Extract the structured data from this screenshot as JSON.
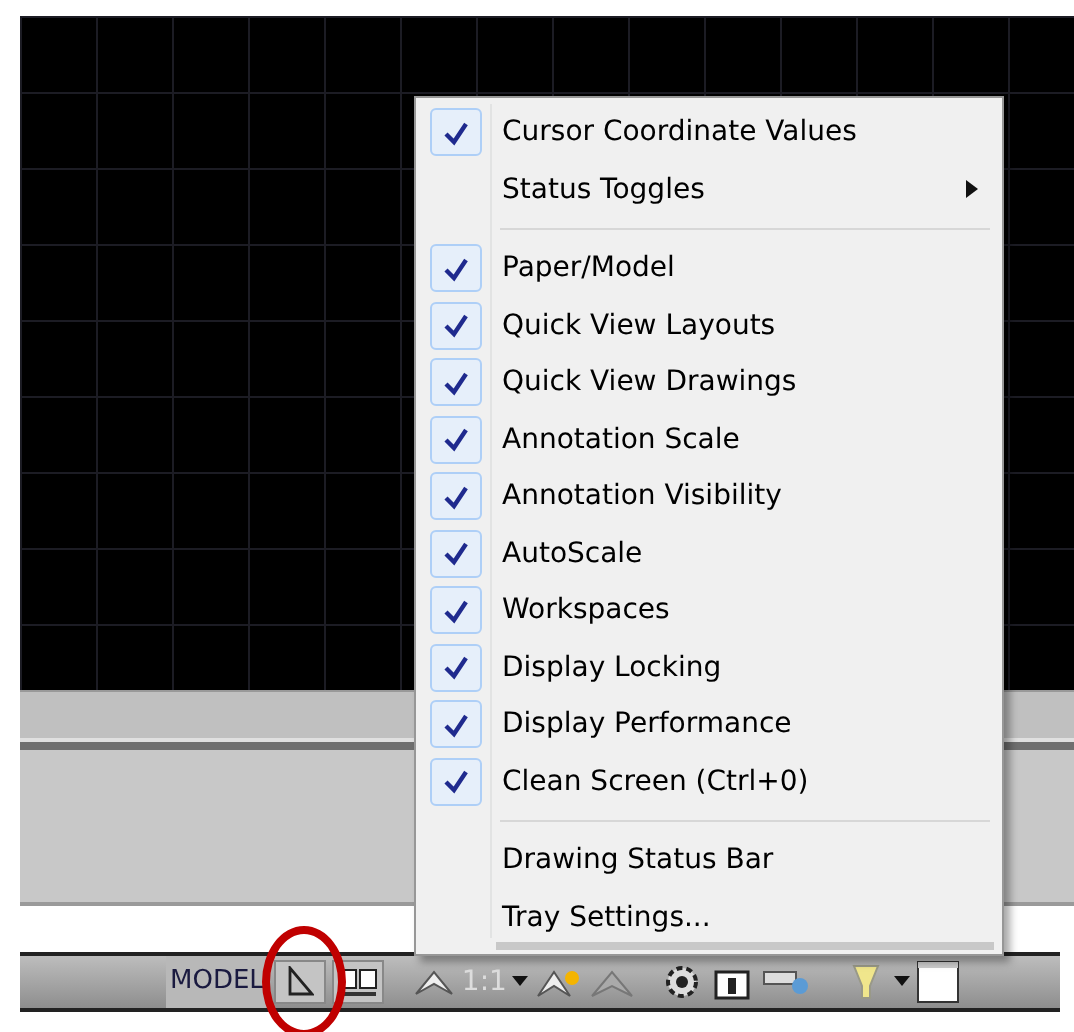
{
  "menu": {
    "sections": [
      {
        "items": [
          {
            "label": "Cursor Coordinate Values",
            "checked": true,
            "has_submenu": false
          },
          {
            "label": "Status Toggles",
            "checked": false,
            "has_submenu": true
          }
        ]
      },
      {
        "items": [
          {
            "label": "Paper/Model",
            "checked": true,
            "has_submenu": false
          },
          {
            "label": "Quick View Layouts",
            "checked": true,
            "has_submenu": false
          },
          {
            "label": "Quick View Drawings",
            "checked": true,
            "has_submenu": false
          },
          {
            "label": "Annotation Scale",
            "checked": true,
            "has_submenu": false
          },
          {
            "label": "Annotation Visibility",
            "checked": true,
            "has_submenu": false
          },
          {
            "label": "AutoScale",
            "checked": true,
            "has_submenu": false
          },
          {
            "label": "Workspaces",
            "checked": true,
            "has_submenu": false
          },
          {
            "label": "Display Locking",
            "checked": true,
            "has_submenu": false
          },
          {
            "label": "Display Performance",
            "checked": true,
            "has_submenu": false
          },
          {
            "label": "Clean Screen (Ctrl+0)",
            "checked": true,
            "has_submenu": false
          }
        ]
      },
      {
        "items": [
          {
            "label": "Drawing Status Bar",
            "checked": false,
            "has_submenu": false
          },
          {
            "label": "Tray Settings...",
            "checked": false,
            "has_submenu": false
          }
        ]
      }
    ]
  },
  "status_bar": {
    "mode_label": "MODEL",
    "scale": "1:1"
  }
}
